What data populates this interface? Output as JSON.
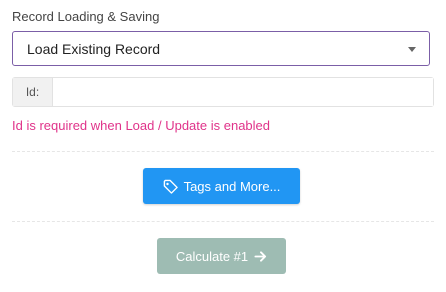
{
  "record_section": {
    "label": "Record Loading & Saving",
    "mode_select": {
      "selected": "Load Existing Record"
    },
    "id_field": {
      "label": "Id:",
      "value": ""
    },
    "error_message": "Id is required when Load / Update is enabled"
  },
  "buttons": {
    "tags_label": "Tags and More...",
    "tags_icon": "tag-icon",
    "calculate_label": "Calculate #1",
    "calculate_icon": "arrow-right-icon"
  },
  "colors": {
    "select_border": "#7b5ea7",
    "error": "#e0338a",
    "tags_button": "#2196f3",
    "calculate_button": "#9ebcb3"
  }
}
